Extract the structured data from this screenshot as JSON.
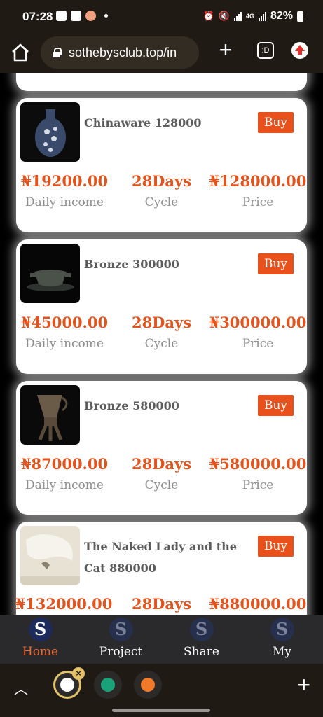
{
  "status_bar": {
    "time": "07:28",
    "battery": "82%",
    "network": "4G"
  },
  "browser": {
    "url": "sothebysclub.top/in",
    "tabs_label": ":D"
  },
  "products": [
    {
      "name": "Chinaware 128000",
      "buy_label": "Buy",
      "daily_income": "₦19200.00",
      "daily_income_label": "Daily income",
      "cycle": "28Days",
      "cycle_label": "Cycle",
      "price": "₦128000.00",
      "price_label": "Price"
    },
    {
      "name": "Bronze 300000",
      "buy_label": "Buy",
      "daily_income": "₦45000.00",
      "daily_income_label": "Daily income",
      "cycle": "28Days",
      "cycle_label": "Cycle",
      "price": "₦300000.00",
      "price_label": "Price"
    },
    {
      "name": "Bronze 580000",
      "buy_label": "Buy",
      "daily_income": "₦87000.00",
      "daily_income_label": "Daily income",
      "cycle": "28Days",
      "cycle_label": "Cycle",
      "price": "₦580000.00",
      "price_label": "Price"
    },
    {
      "name": "The Naked Lady and the Cat 880000",
      "buy_label": "Buy",
      "daily_income": "₦132000.00",
      "cycle": "28Days",
      "price": "₦880000.00"
    }
  ],
  "nav": [
    {
      "label": "Home",
      "icon": "S",
      "active": true
    },
    {
      "label": "Project",
      "icon": "S"
    },
    {
      "label": "Share",
      "icon": "S"
    },
    {
      "label": "My",
      "icon": "S"
    }
  ],
  "dock": {
    "close_label": "×",
    "new_tab_label": "+"
  },
  "colors": {
    "accent": "#e2541d",
    "buy": "#e8511c",
    "nav_active": "#ef6a35"
  }
}
